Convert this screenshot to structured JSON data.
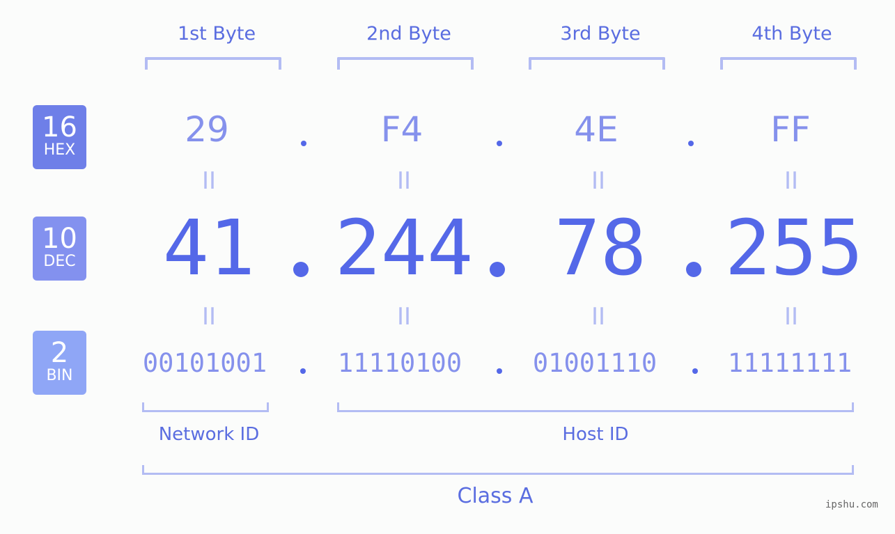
{
  "bytes": [
    {
      "label": "1st Byte",
      "hex": "29",
      "dec": "41",
      "bin": "00101001"
    },
    {
      "label": "2nd Byte",
      "hex": "F4",
      "dec": "244",
      "bin": "11110100"
    },
    {
      "label": "3rd Byte",
      "hex": "4E",
      "dec": "78",
      "bin": "01001110"
    },
    {
      "label": "4th Byte",
      "hex": "FF",
      "dec": "255",
      "bin": "11111111"
    }
  ],
  "badges": {
    "hex": {
      "num": "16",
      "unit": "HEX",
      "color": "#6e7fe8"
    },
    "dec": {
      "num": "10",
      "unit": "DEC",
      "color": "#8391ef"
    },
    "bin": {
      "num": "2",
      "unit": "BIN",
      "color": "#8fa6f6"
    }
  },
  "equals_glyph": "II",
  "groups": {
    "network": "Network ID",
    "host": "Host ID",
    "class": "Class A"
  },
  "watermark": "ipshu.com",
  "colors": {
    "accent": "#5468e8",
    "light": "#8591ec",
    "bracket": "#b3bcf3"
  }
}
